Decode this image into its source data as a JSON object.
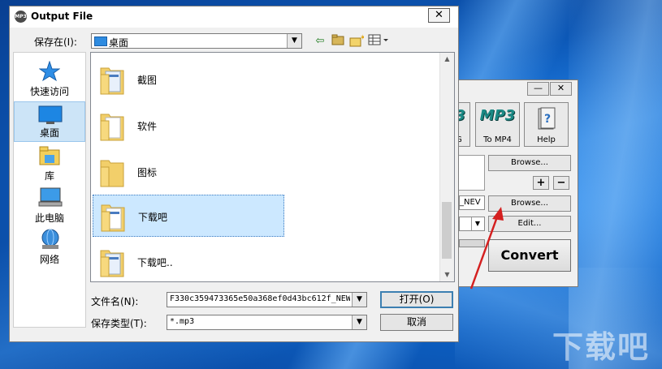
{
  "dialog": {
    "title": "Output File",
    "close_glyph": "✕",
    "lookin_label": "保存在(I):",
    "lookin_value": "桌面",
    "places": [
      {
        "label": "快速访问",
        "icon": "star-icon"
      },
      {
        "label": "桌面",
        "icon": "desktop-icon",
        "selected": true
      },
      {
        "label": "库",
        "icon": "library-icon"
      },
      {
        "label": "此电脑",
        "icon": "computer-icon"
      },
      {
        "label": "网络",
        "icon": "network-icon"
      }
    ],
    "files": [
      {
        "name": "截图"
      },
      {
        "name": "软件"
      },
      {
        "name": "图标"
      },
      {
        "name": "下载吧",
        "selected": true
      },
      {
        "name": "下载吧.."
      }
    ],
    "filename_label": "文件名(N):",
    "filename_value": "F330c359473365e50a368ef0d43bc612f_NEW",
    "filetype_label": "保存类型(T):",
    "filetype_value": "*.mp3",
    "open_button": "打开(O)",
    "cancel_button": "取消"
  },
  "background_app": {
    "tile_mp3_text": "MP3",
    "tile_to_mp4": "To MP4",
    "tile_help": "Help",
    "tile_partial_letter": "3",
    "tile_partial_caption": "G",
    "browse_1": "Browse...",
    "plus": "+",
    "minus": "−",
    "partial_field": "_NEV",
    "browse_2": "Browse...",
    "edit": "Edit...",
    "convert": "Convert",
    "min_glyph": "—",
    "close_glyph": "✕"
  },
  "watermark": {
    "text": "下载吧"
  }
}
